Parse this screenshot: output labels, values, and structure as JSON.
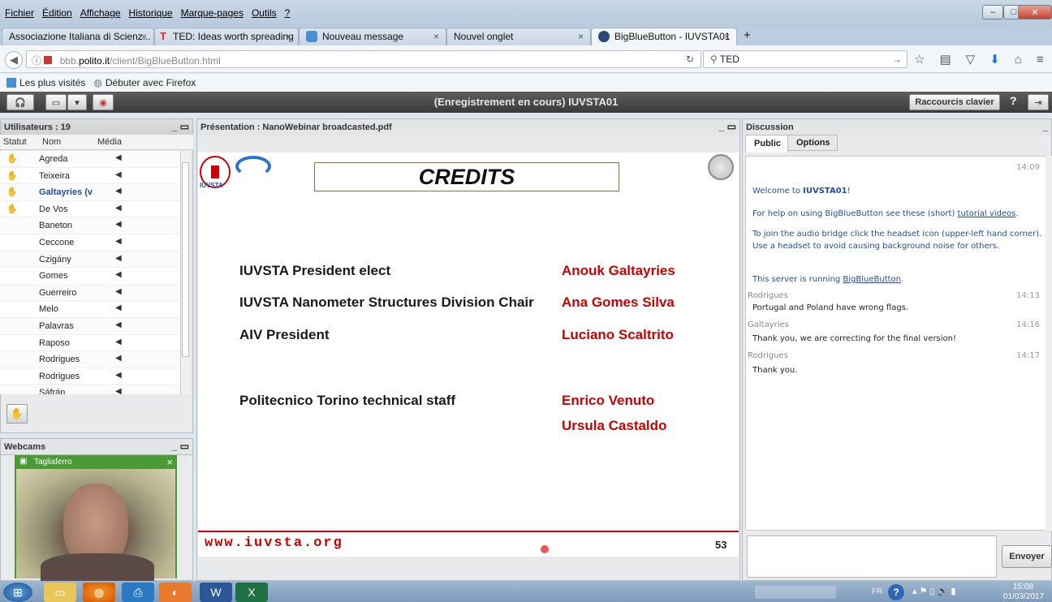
{
  "browser": {
    "menu": [
      "Fichier",
      "Édition",
      "Affichage",
      "Historique",
      "Marque-pages",
      "Outils",
      "?"
    ],
    "tabs": [
      {
        "label": "Associazione Italiana di Scienz...",
        "close": "×"
      },
      {
        "label": "TED: Ideas worth spreading",
        "close": "×"
      },
      {
        "label": "Nouveau message",
        "close": "×"
      },
      {
        "label": "Nouvel onglet",
        "close": "×"
      },
      {
        "label": "BigBlueButton - IUVSTA01",
        "close": "×"
      }
    ],
    "new_tab": "+",
    "url_prefix": "bbb.",
    "url_domain": "polito.it",
    "url_path": "/client/BigBlueButton.html",
    "search_value": "TED",
    "bookmarks": [
      "Les plus visités",
      "Débuter avec Firefox"
    ]
  },
  "bbb": {
    "title": "(Enregistrement en cours) IUVSTA01",
    "shortcuts_label": "Raccourcis clavier",
    "help_label": "?"
  },
  "users": {
    "title": "Utilisateurs : 19",
    "columns": [
      "Statut",
      "Nom",
      "Média"
    ],
    "rows": [
      {
        "name": "Agreda",
        "hand": true
      },
      {
        "name": "Teixeira",
        "hand": true
      },
      {
        "name": "Galtayries (vo",
        "hand": true
      },
      {
        "name": "De Vos",
        "hand": true
      },
      {
        "name": "Baneton",
        "hand": false
      },
      {
        "name": "Ceccone",
        "hand": false
      },
      {
        "name": "Czigány",
        "hand": false
      },
      {
        "name": "Gomes",
        "hand": false
      },
      {
        "name": "Guerreiro",
        "hand": false
      },
      {
        "name": "Melo",
        "hand": false
      },
      {
        "name": "Palavras",
        "hand": false
      },
      {
        "name": "Raposo",
        "hand": false
      },
      {
        "name": "Rodrigues",
        "hand": false
      },
      {
        "name": "Rodrigues",
        "hand": false
      },
      {
        "name": "Sáfrán",
        "hand": false
      }
    ]
  },
  "webcams": {
    "title": "Webcams",
    "user": "Tagliaferro",
    "close": "×"
  },
  "presentation": {
    "title": "Présentation : NanoWebinar broadcasted.pdf",
    "slide_title": "CREDITS",
    "logo_text": "IUVSTA",
    "rows": [
      {
        "role": "IUVSTA President elect",
        "name": "Anouk Galtayries"
      },
      {
        "role": "IUVSTA Nanometer Structures Division Chair",
        "name": "Ana Gomes Silva"
      },
      {
        "role": "AIV President",
        "name": "Luciano Scaltrito"
      },
      {
        "role": "Politecnico Torino technical staff",
        "name": "Enrico Venuto"
      },
      {
        "role": "",
        "name": "Ursula Castaldo"
      }
    ],
    "footer_url": "www.iuvsta.org",
    "page": "53"
  },
  "discussion": {
    "title": "Discussion",
    "tabs": [
      "Public",
      "Options"
    ],
    "first_time": "14:09",
    "welcome_pre": "Welcome to ",
    "welcome_room": "IUVSTA01",
    "welcome_post": "!",
    "help_pre": "For help on using BigBlueButton see these (short) ",
    "help_link": "tutorial videos",
    "help_post": ".",
    "audio_1": "To join the audio bridge click the headset icon (upper-left hand corner).",
    "audio_2": "Use a headset to avoid causing background noise for others.",
    "server_pre": "This server is running ",
    "server_link": "BigBlueButton",
    "server_post": ".",
    "messages": [
      {
        "user": "Rodrigues",
        "time": "14:13",
        "text": "Portugal and Poland have wrong flags."
      },
      {
        "user": "Galtayries",
        "time": "14:16",
        "text": "Thank you, we are correcting for the final version!"
      },
      {
        "user": "Rodrigues",
        "time": "14:17",
        "text": "Thank you."
      }
    ],
    "send_label": "Envoyer"
  },
  "taskbar": {
    "lang": "FR",
    "time": "15:08",
    "date": "01/03/2017"
  },
  "colors": {
    "accent_red": "#c00000",
    "link_blue": "#1f4ea8",
    "bbb_dark": "#3a3a3a"
  }
}
